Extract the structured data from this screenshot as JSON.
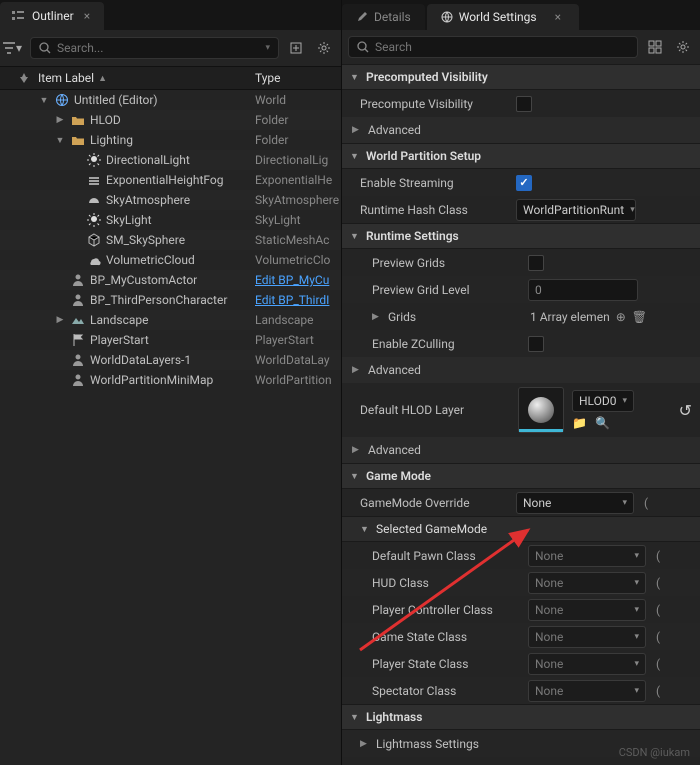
{
  "outliner": {
    "tab": "Outliner",
    "search_placeholder": "Search...",
    "columns": {
      "label": "Item Label",
      "type": "Type"
    },
    "rows": [
      {
        "depth": 0,
        "expand": "down",
        "icon": "world",
        "label": "Untitled (Editor)",
        "type": "World",
        "link": false
      },
      {
        "depth": 1,
        "expand": "right",
        "icon": "folder",
        "label": "HLOD",
        "type": "Folder",
        "link": false
      },
      {
        "depth": 1,
        "expand": "down",
        "icon": "folder",
        "label": "Lighting",
        "type": "Folder",
        "link": false
      },
      {
        "depth": 2,
        "expand": "",
        "icon": "light",
        "label": "DirectionalLight",
        "type": "DirectionalLig",
        "link": false
      },
      {
        "depth": 2,
        "expand": "",
        "icon": "fog",
        "label": "ExponentialHeightFog",
        "type": "ExponentialHe",
        "link": false
      },
      {
        "depth": 2,
        "expand": "",
        "icon": "sky",
        "label": "SkyAtmosphere",
        "type": "SkyAtmosphere",
        "link": false
      },
      {
        "depth": 2,
        "expand": "",
        "icon": "light",
        "label": "SkyLight",
        "type": "SkyLight",
        "link": false
      },
      {
        "depth": 2,
        "expand": "",
        "icon": "mesh",
        "label": "SM_SkySphere",
        "type": "StaticMeshAc",
        "link": false
      },
      {
        "depth": 2,
        "expand": "",
        "icon": "cloud",
        "label": "VolumetricCloud",
        "type": "VolumetricClo",
        "link": false
      },
      {
        "depth": 1,
        "expand": "",
        "icon": "actor",
        "label": "BP_MyCustomActor",
        "type": "Edit BP_MyCu",
        "link": true
      },
      {
        "depth": 1,
        "expand": "",
        "icon": "actor",
        "label": "BP_ThirdPersonCharacter",
        "type": "Edit BP_ThirdI",
        "link": true
      },
      {
        "depth": 1,
        "expand": "right",
        "icon": "land",
        "label": "Landscape",
        "type": "Landscape",
        "link": false
      },
      {
        "depth": 1,
        "expand": "",
        "icon": "flag",
        "label": "PlayerStart",
        "type": "PlayerStart",
        "link": false
      },
      {
        "depth": 1,
        "expand": "",
        "icon": "data",
        "label": "WorldDataLayers-1",
        "type": "WorldDataLay",
        "link": false
      },
      {
        "depth": 1,
        "expand": "",
        "icon": "data",
        "label": "WorldPartitionMiniMap",
        "type": "WorldPartition",
        "link": false
      }
    ]
  },
  "details": {
    "tab_inactive": "Details",
    "tab_active": "World Settings",
    "search_placeholder": "Search",
    "cats": {
      "precomp": "Precomputed Visibility",
      "wps": "World Partition Setup",
      "runtime": "Runtime Settings",
      "gamemode": "Game Mode",
      "selgm": "Selected GameMode",
      "lightmass": "Lightmass"
    },
    "labels": {
      "precompute_visibility": "Precompute Visibility",
      "advanced": "Advanced",
      "enable_streaming": "Enable Streaming",
      "runtime_hash_class": "Runtime Hash Class",
      "preview_grids": "Preview Grids",
      "preview_grid_level": "Preview Grid Level",
      "grids": "Grids",
      "enable_zculling": "Enable ZCulling",
      "default_hlod_layer": "Default HLOD Layer",
      "gamemode_override": "GameMode Override",
      "default_pawn_class": "Default Pawn Class",
      "hud_class": "HUD Class",
      "player_controller_class": "Player Controller Class",
      "game_state_class": "Game State Class",
      "player_state_class": "Player State Class",
      "spectator_class": "Spectator Class",
      "lightmass_settings": "Lightmass Settings"
    },
    "values": {
      "runtime_hash_class": "WorldPartitionRunt",
      "preview_grid_level": "0",
      "grids_summary": "1 Array elemen",
      "hlod_dropdown": "HLOD0",
      "none": "None"
    }
  },
  "watermark": "CSDN @iukam"
}
